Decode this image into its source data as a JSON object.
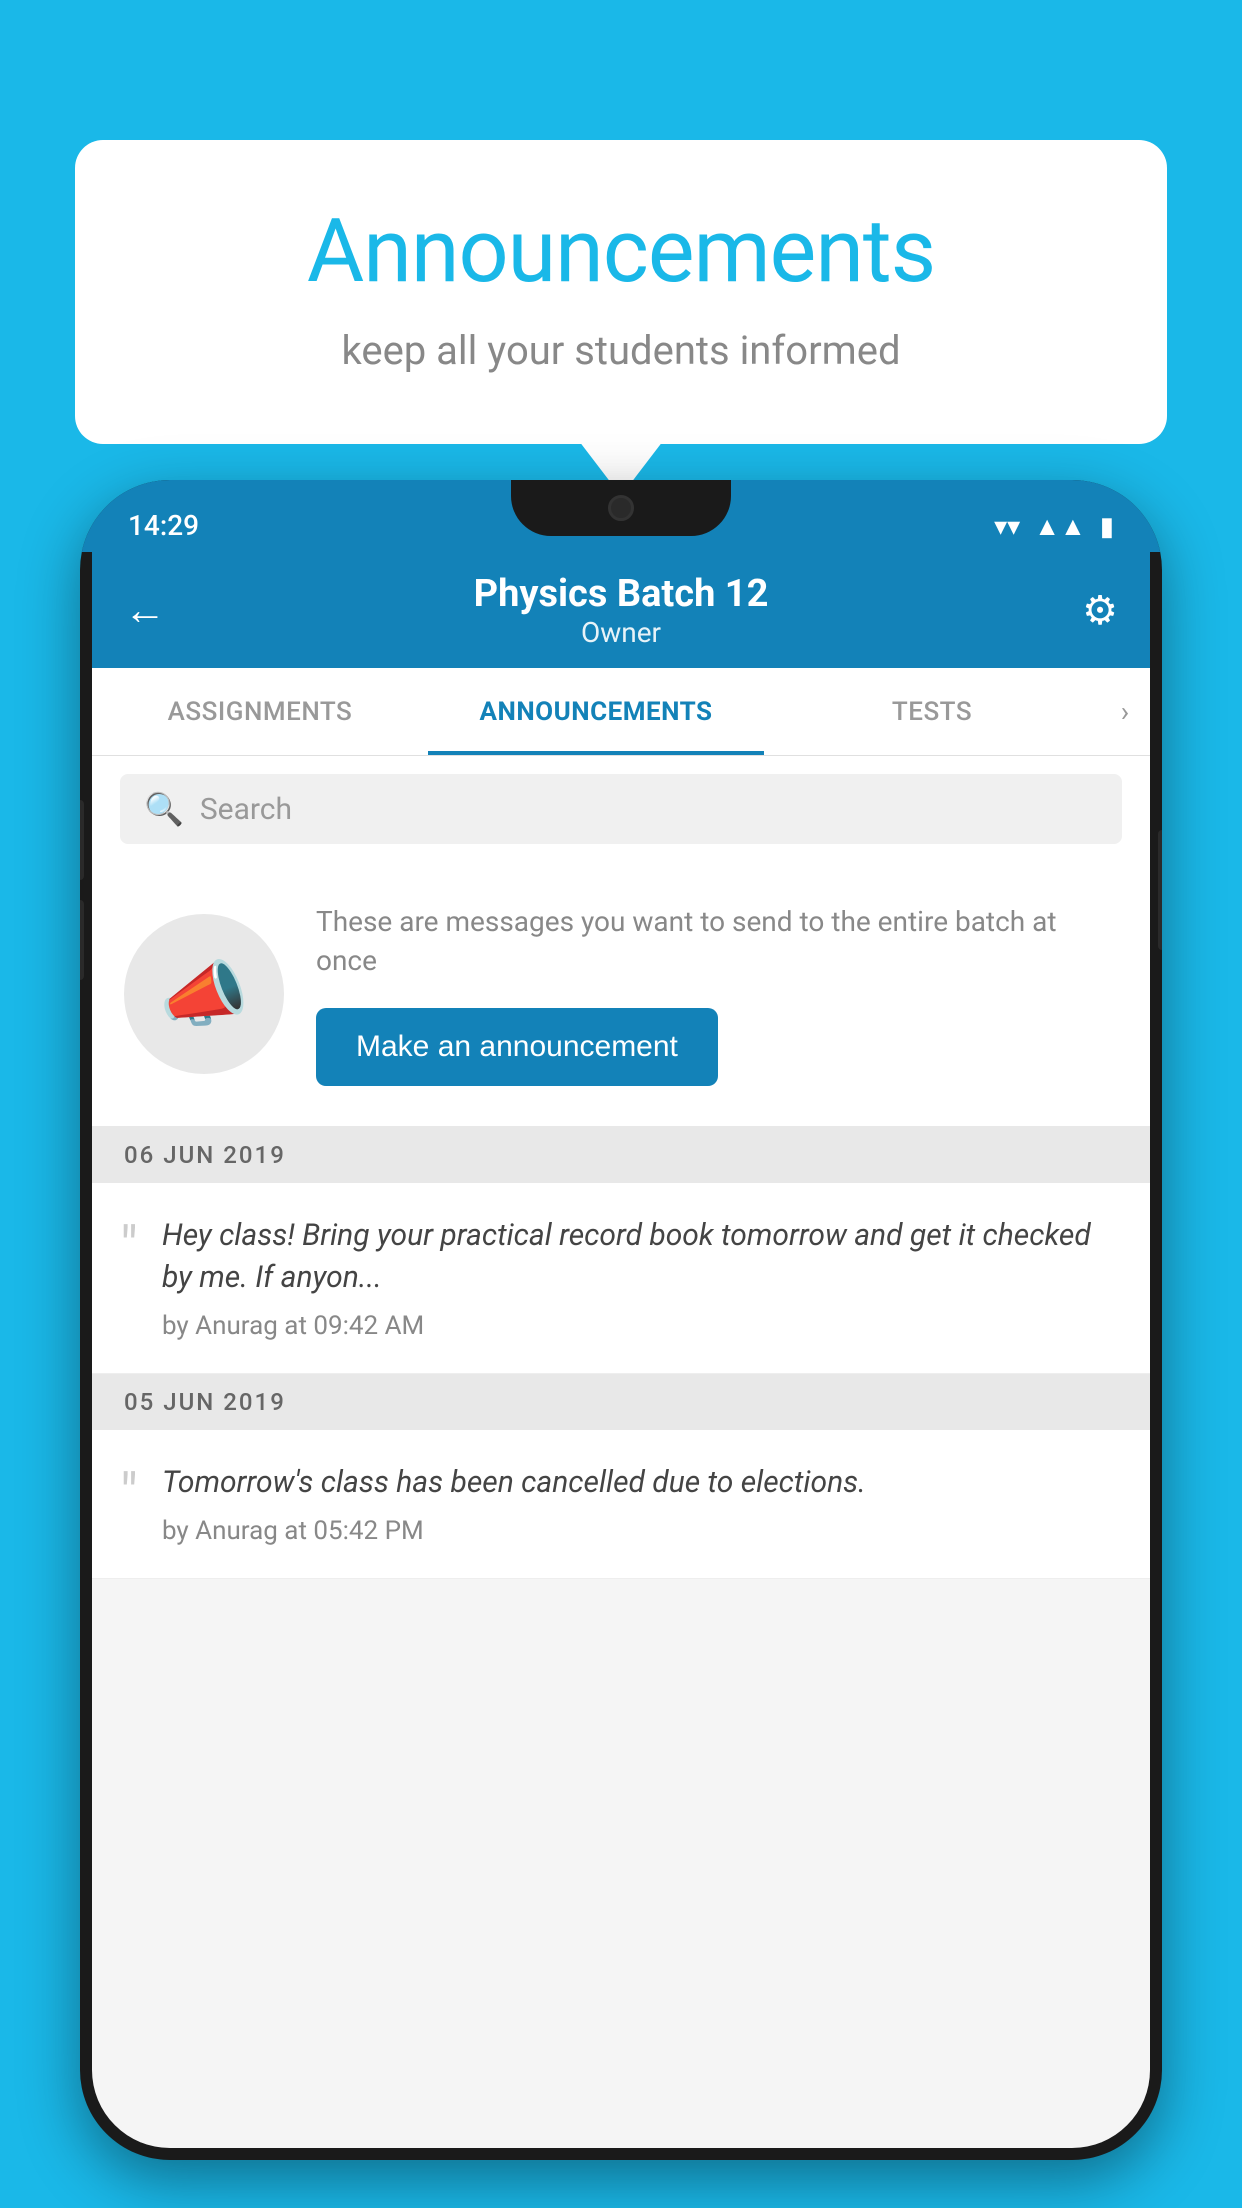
{
  "background_color": "#1ab8e8",
  "speech_bubble": {
    "title": "Announcements",
    "subtitle": "keep all your students informed"
  },
  "phone": {
    "status_bar": {
      "time": "14:29",
      "icons": [
        "wifi",
        "signal",
        "battery"
      ]
    },
    "top_bar": {
      "title": "Physics Batch 12",
      "subtitle": "Owner",
      "back_label": "←",
      "settings_label": "⚙"
    },
    "tabs": [
      {
        "label": "ASSIGNMENTS",
        "active": false
      },
      {
        "label": "ANNOUNCEMENTS",
        "active": true
      },
      {
        "label": "TESTS",
        "active": false
      }
    ],
    "search": {
      "placeholder": "Search"
    },
    "promo": {
      "description": "These are messages you want to send to the entire batch at once",
      "button_label": "Make an announcement"
    },
    "announcements": [
      {
        "date": "06  JUN  2019",
        "text": "Hey class! Bring your practical record book tomorrow and get it checked by me. If anyon...",
        "meta": "by Anurag at 09:42 AM"
      },
      {
        "date": "05  JUN  2019",
        "text": "Tomorrow's class has been cancelled due to elections.",
        "meta": "by Anurag at 05:42 PM"
      }
    ]
  }
}
